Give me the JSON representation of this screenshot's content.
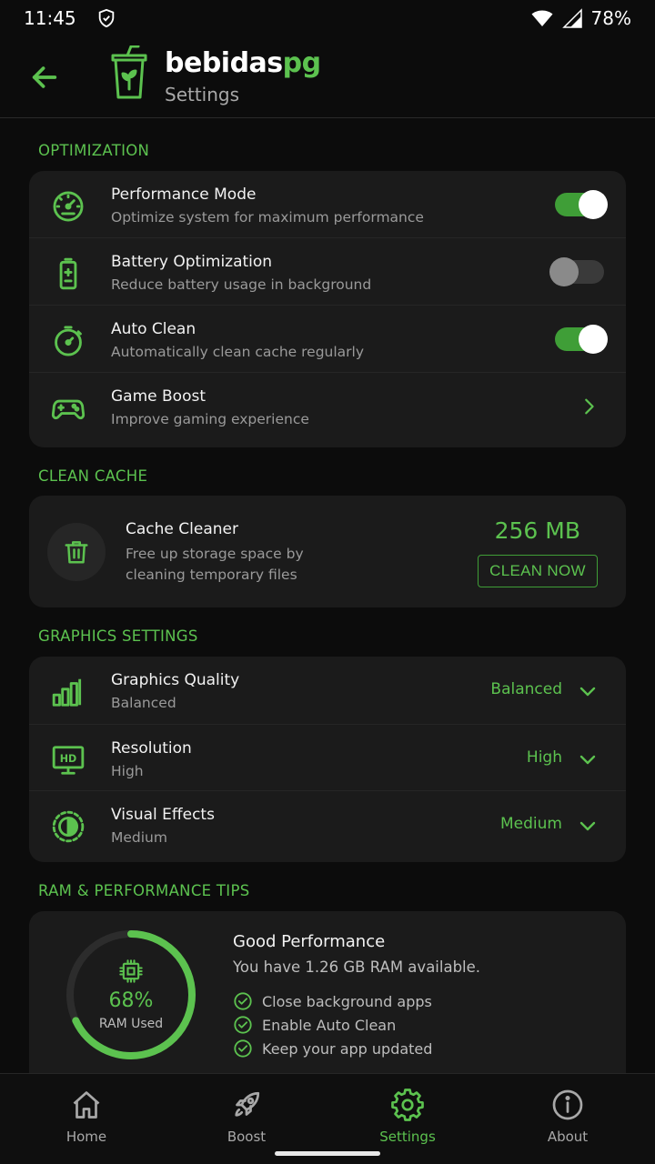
{
  "status_bar": {
    "time": "11:45",
    "battery": "78%"
  },
  "header": {
    "brand_main": "bebidas",
    "brand_accent": "pg",
    "subtitle": "Settings"
  },
  "sections": {
    "optimization": "OPTIMIZATION",
    "clean_cache": "CLEAN CACHE",
    "graphics": "GRAPHICS SETTINGS",
    "ram": "RAM & PERFORMANCE TIPS"
  },
  "optimization": [
    {
      "title": "Performance Mode",
      "subtitle": "Optimize system for maximum performance",
      "toggle": true
    },
    {
      "title": "Battery Optimization",
      "subtitle": "Reduce battery usage in background",
      "toggle": false
    },
    {
      "title": "Auto Clean",
      "subtitle": "Automatically clean cache regularly",
      "toggle": true
    },
    {
      "title": "Game Boost",
      "subtitle": "Improve gaming experience"
    }
  ],
  "cache": {
    "title": "Cache Cleaner",
    "description": "Free up storage space by cleaning temporary files",
    "size": "256 MB",
    "button": "CLEAN NOW"
  },
  "graphics": [
    {
      "title": "Graphics Quality",
      "subtitle": "Balanced",
      "value": "Balanced"
    },
    {
      "title": "Resolution",
      "subtitle": "High",
      "value": "High"
    },
    {
      "title": "Visual Effects",
      "subtitle": "Medium",
      "value": "Medium"
    }
  ],
  "ram": {
    "percent": "68%",
    "percent_value": 68,
    "label": "RAM Used",
    "title": "Good Performance",
    "subtitle": "You have 1.26 GB RAM available.",
    "tips": [
      "Close background apps",
      "Enable Auto Clean",
      "Keep your app updated"
    ]
  },
  "nav": [
    {
      "label": "Home",
      "icon": "home-icon"
    },
    {
      "label": "Boost",
      "icon": "rocket-icon"
    },
    {
      "label": "Settings",
      "icon": "gear-icon",
      "active": true
    },
    {
      "label": "About",
      "icon": "info-icon"
    }
  ],
  "colors": {
    "accent": "#5cc24f",
    "background": "#0c0c0c",
    "card": "#1b1b1b",
    "toggle_on": "#3f9e37"
  }
}
